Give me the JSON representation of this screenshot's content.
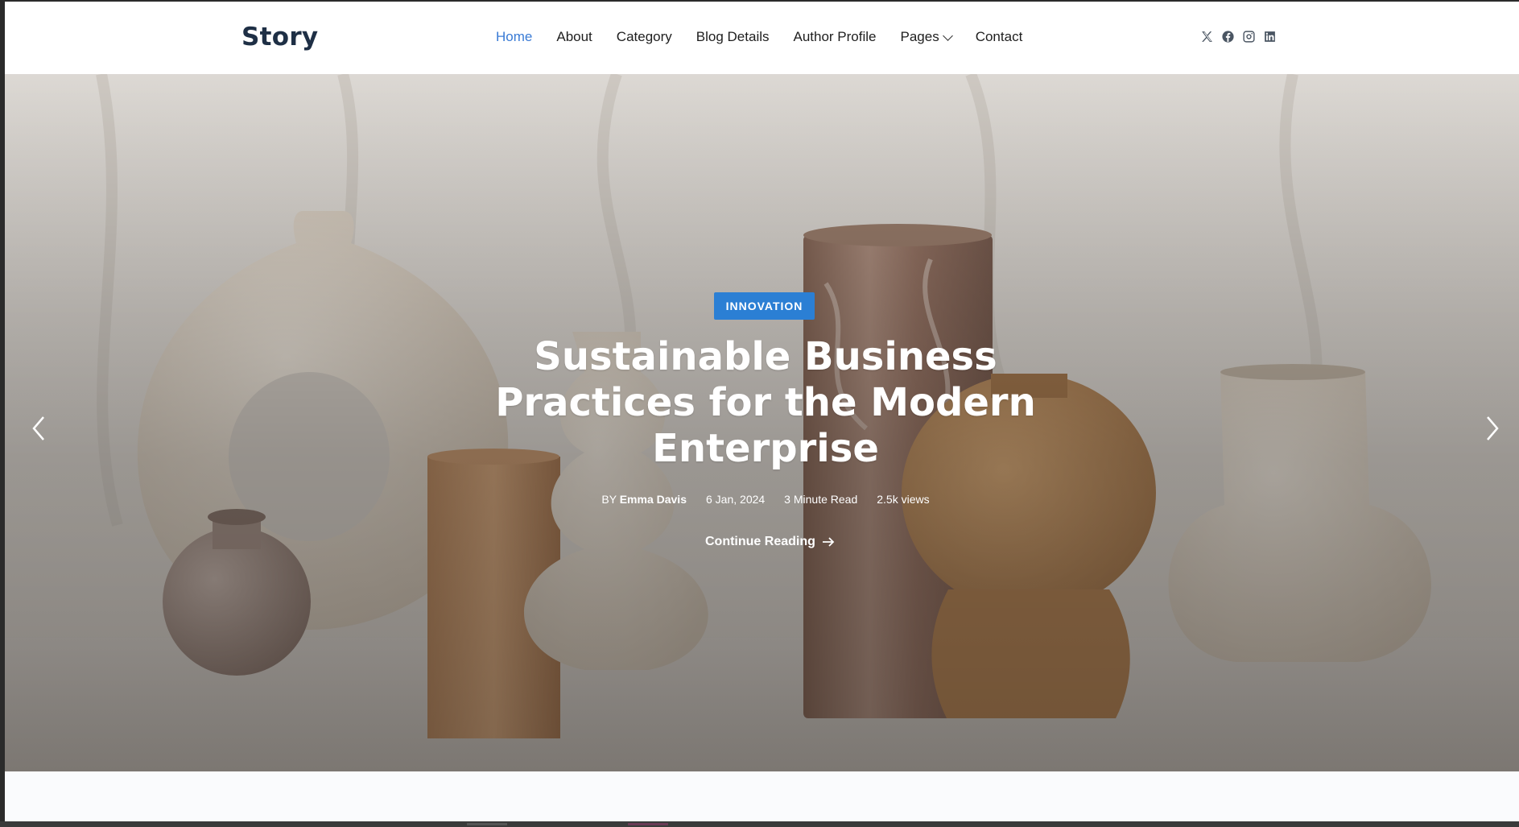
{
  "brand": {
    "logo": "Story"
  },
  "nav": {
    "items": [
      {
        "label": "Home",
        "active": true
      },
      {
        "label": "About"
      },
      {
        "label": "Category"
      },
      {
        "label": "Blog Details"
      },
      {
        "label": "Author Profile"
      },
      {
        "label": "Pages",
        "has_dropdown": true
      },
      {
        "label": "Contact"
      }
    ]
  },
  "social": {
    "icons": [
      "x-icon",
      "facebook-icon",
      "instagram-icon",
      "linkedin-icon"
    ]
  },
  "hero": {
    "category": "INNOVATION",
    "title": "Sustainable Business Practices for the Modern Enterprise",
    "by_prefix": "BY",
    "author": "Emma Davis",
    "date": "6 Jan, 2024",
    "read_time": "3 Minute Read",
    "views": "2.5k views",
    "cta": "Continue Reading"
  },
  "colors": {
    "accent": "#2b7fd4",
    "active_nav": "#3a7bd5",
    "logo": "#1e2f45"
  }
}
